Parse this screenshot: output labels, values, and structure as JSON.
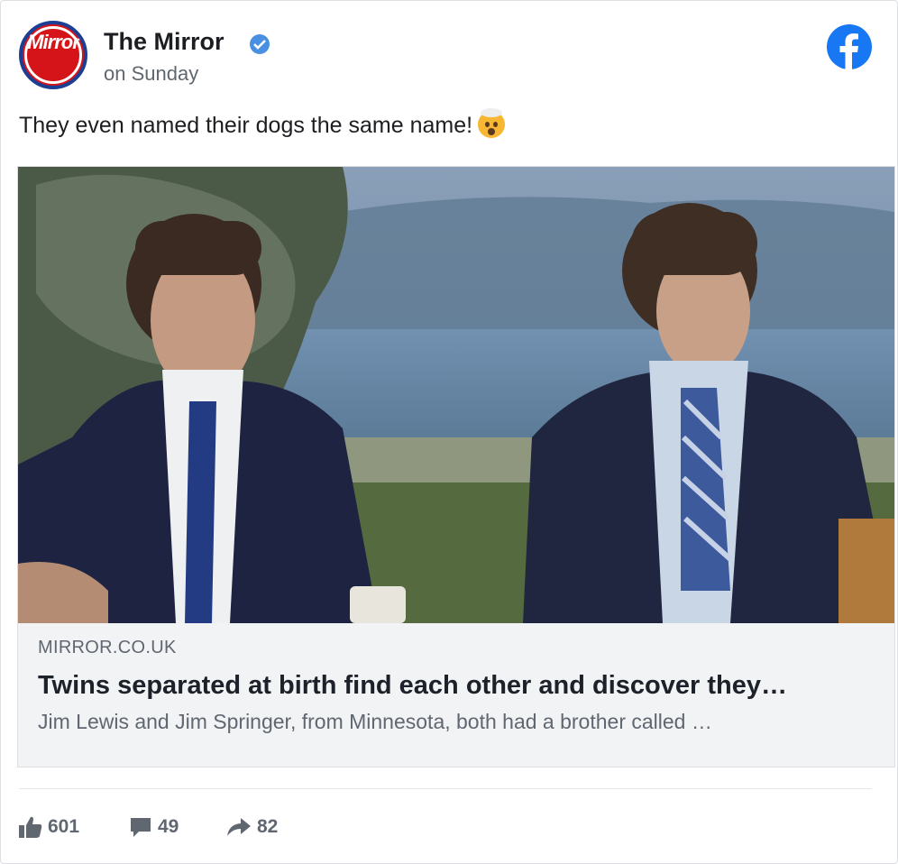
{
  "post": {
    "page_name": "The Mirror",
    "avatar_text": "Mirror",
    "timestamp": "on Sunday",
    "text": "They even named their dogs the same name!",
    "emoji": "exploding-head-emoji"
  },
  "link_preview": {
    "domain": "MIRROR.CO.UK",
    "headline": "Twins separated at birth find each other and discover they…",
    "description": "Jim Lewis and Jim Springer, from Minnesota, both had a brother called …"
  },
  "stats": {
    "likes": "601",
    "comments": "49",
    "shares": "82"
  },
  "colors": {
    "brand_red": "#d51419",
    "facebook_blue": "#1877f2",
    "verified_blue": "#4a90e2",
    "muted_text": "#606770"
  },
  "icons": [
    "verified-badge-icon",
    "facebook-logo-icon",
    "like-icon",
    "comment-icon",
    "share-icon"
  ]
}
